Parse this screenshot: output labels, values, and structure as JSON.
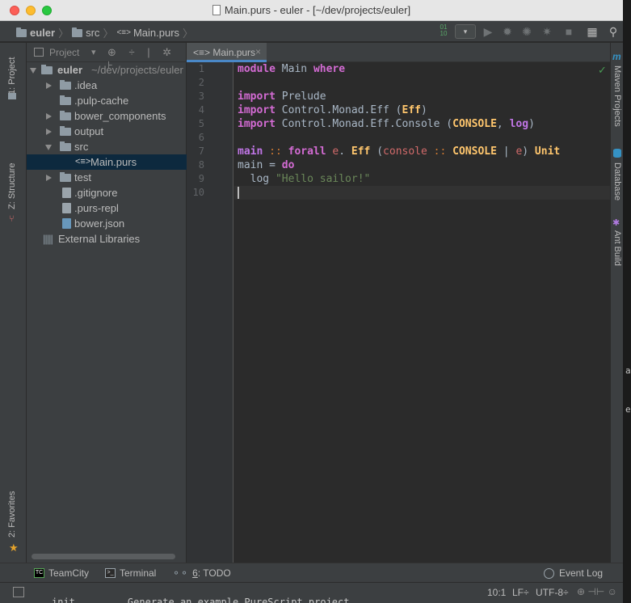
{
  "window": {
    "title": "Main.purs - euler - [~/dev/projects/euler]"
  },
  "navbar": {
    "crumbs": [
      "euler",
      "src",
      "Main.purs"
    ],
    "run_config_symbol": "▾",
    "purs_symbol": "<≡>",
    "sep": "〉",
    "icons": [
      "binary-icon",
      "run-icon",
      "debug-icon",
      "coverage-icon",
      "profile-icon",
      "stop-icon",
      "project-structure-icon",
      "search-icon"
    ]
  },
  "left_strip": {
    "tabs": [
      "1: Project",
      "Z: Structure",
      "2: Favorites"
    ]
  },
  "project_panel": {
    "header_label": "Project",
    "header_arrow": "▾",
    "header_icons": "⊕ ÷ | ✲ ⊦",
    "tree": [
      {
        "label": "euler",
        "suffix": "~/dev/projects/euler",
        "type": "folder",
        "depth": 0,
        "expanded": true
      },
      {
        "label": ".idea",
        "type": "folder",
        "depth": 1,
        "expanded": false
      },
      {
        "label": ".pulp-cache",
        "type": "folder",
        "depth": 1,
        "expanded": null
      },
      {
        "label": "bower_components",
        "type": "folder",
        "depth": 1,
        "expanded": false
      },
      {
        "label": "output",
        "type": "folder",
        "depth": 1,
        "expanded": false
      },
      {
        "label": "src",
        "type": "folder",
        "depth": 1,
        "expanded": true
      },
      {
        "label": "Main.purs",
        "type": "purs",
        "depth": 2,
        "selected": true
      },
      {
        "label": "test",
        "type": "folder",
        "depth": 1,
        "expanded": false
      },
      {
        "label": ".gitignore",
        "type": "file",
        "depth": 1
      },
      {
        "label": ".purs-repl",
        "type": "file",
        "depth": 1
      },
      {
        "label": "bower.json",
        "type": "json",
        "depth": 1
      },
      {
        "label": "External Libraries",
        "type": "libs",
        "depth": 0
      }
    ]
  },
  "editor": {
    "tab_label": "<≡> Main.purs",
    "tab_close": "×",
    "line_numbers": [
      "1",
      "2",
      "3",
      "4",
      "5",
      "6",
      "7",
      "8",
      "9",
      "10"
    ],
    "caret_line": 10,
    "check_mark": "✓",
    "lines": [
      [
        {
          "t": "module",
          "c": "kw2"
        },
        {
          "t": " Main "
        },
        {
          "t": "where",
          "c": "kw2"
        }
      ],
      [],
      [
        {
          "t": "import",
          "c": "kw2"
        },
        {
          "t": " Prelude"
        }
      ],
      [
        {
          "t": "import",
          "c": "kw2"
        },
        {
          "t": " Control.Monad.Eff ("
        },
        {
          "t": "Eff",
          "c": "ty"
        },
        {
          "t": ")"
        }
      ],
      [
        {
          "t": "import",
          "c": "kw2"
        },
        {
          "t": " Control.Monad.Eff.Console ("
        },
        {
          "t": "CONSOLE",
          "c": "ty"
        },
        {
          "t": ", "
        },
        {
          "t": "log",
          "c": "fn"
        },
        {
          "t": ")"
        }
      ],
      [],
      [
        {
          "t": "main",
          "c": "fn"
        },
        {
          "t": " :: ",
          "c": "op"
        },
        {
          "t": "forall",
          "c": "kw2"
        },
        {
          "t": " "
        },
        {
          "t": "e",
          "c": "var"
        },
        {
          "t": ". "
        },
        {
          "t": "Eff",
          "c": "ty"
        },
        {
          "t": " ("
        },
        {
          "t": "console",
          "c": "var"
        },
        {
          "t": " :: ",
          "c": "op"
        },
        {
          "t": "CONSOLE",
          "c": "ty"
        },
        {
          "t": " | "
        },
        {
          "t": "e",
          "c": "var"
        },
        {
          "t": ") "
        },
        {
          "t": "Unit",
          "c": "ty"
        }
      ],
      [
        {
          "t": "main = "
        },
        {
          "t": "do",
          "c": "kw2"
        }
      ],
      [
        {
          "t": "  log "
        },
        {
          "t": "\"Hello sailor!\"",
          "c": "str"
        }
      ],
      []
    ]
  },
  "right_strip": {
    "tabs": [
      "Maven Projects",
      "Database",
      "Ant Build"
    ],
    "maven_glyph": "m"
  },
  "bottom_bar": {
    "teamcity": "TeamCity",
    "terminal": "Terminal",
    "todo_prefix": "6",
    "todo_suffix": ": TODO",
    "event_log": "Event Log"
  },
  "status_bar": {
    "position": "10:1",
    "line_sep": "LF÷",
    "encoding": "UTF-8÷",
    "icons": "⊕  ⊣⊢  ☺"
  },
  "background_text": {
    "line1": "a",
    "line2": "e",
    "bottom": "init         Generate an example PureScript project"
  }
}
